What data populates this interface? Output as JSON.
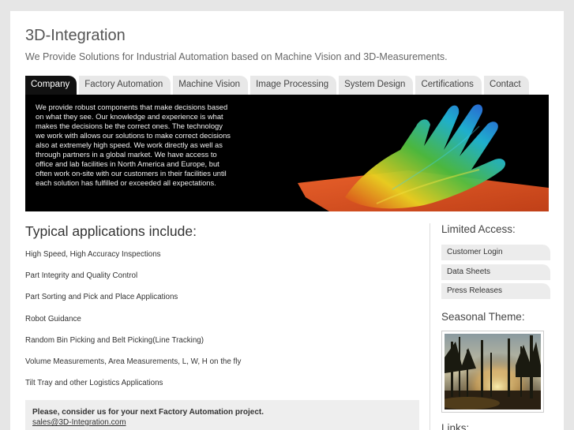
{
  "site": {
    "title": "3D-Integration",
    "tagline": "We Provide Solutions for Industrial Automation based on Machine Vision and 3D-Measurements."
  },
  "nav": {
    "tabs": [
      {
        "label": "Company",
        "active": true
      },
      {
        "label": "Factory Automation"
      },
      {
        "label": "Machine Vision"
      },
      {
        "label": "Image Processing"
      },
      {
        "label": "System Design"
      },
      {
        "label": "Certifications"
      },
      {
        "label": "Contact"
      }
    ]
  },
  "hero": {
    "lines": [
      "We provide robust components that make decisions based",
      "on what they see. Our knowledge and experience is what",
      "makes the decisions be the correct ones. The technology",
      "we work with allows our solutions to make correct decisions",
      "also at extremely high speed. We work directly as well as",
      "through partners in a global market. We have access to",
      "office and lab facilities in North America and Europe, but",
      "often work on-site with our customers in their facilities until",
      "each solution has fulfilled or exceeded all expectations."
    ]
  },
  "main": {
    "heading": "Typical applications include:",
    "applications": [
      "High Speed, High Accuracy Inspections",
      "Part Integrity and Quality Control",
      "Part Sorting and Pick and Place Applications",
      "Robot Guidance",
      "Random Bin Picking and Belt Picking(Line Tracking)",
      "Volume Measurements, Area Measurements, L, W, H on the fly",
      "Tilt Tray and other Logistics Applications"
    ],
    "cta_text": "Please, consider us for your next Factory Automation project.",
    "cta_email": "sales@3D-Integration.com"
  },
  "sidebar": {
    "limited_access_heading": "Limited Access:",
    "items": [
      "Customer Login",
      "Data Sheets",
      "Press Releases"
    ],
    "seasonal_heading": "Seasonal Theme:",
    "links_heading": "Links:"
  },
  "colors": {
    "page_background": "#e6e6e6",
    "active_tab": "#111111",
    "hero_background": "#000000"
  }
}
